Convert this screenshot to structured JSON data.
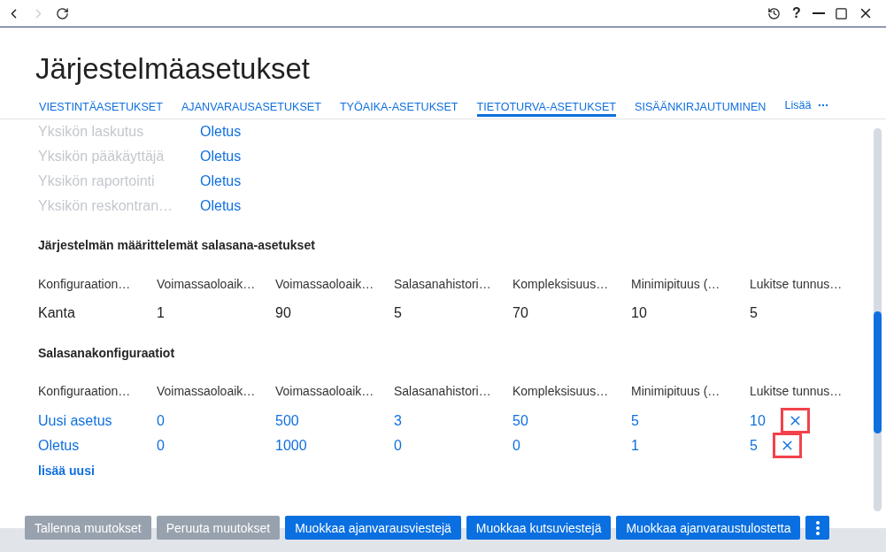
{
  "nav_buttons": [
    {
      "kind": "back",
      "disabled": false
    },
    {
      "kind": "forward",
      "disabled": true
    },
    {
      "kind": "refresh",
      "disabled": false
    }
  ],
  "window_controls": [
    {
      "kind": "history"
    },
    {
      "kind": "help",
      "label": "?"
    },
    {
      "kind": "minimize"
    },
    {
      "kind": "maximize"
    },
    {
      "kind": "close"
    }
  ],
  "page_title": "Järjestelmäasetukset",
  "tabs": [
    {
      "label": "VIESTINTÄASETUKSET",
      "selected": false
    },
    {
      "label": "AJANVARAUSASETUKSET",
      "selected": false
    },
    {
      "label": "TYÖAIKA-ASETUKSET",
      "selected": false
    },
    {
      "label": "TIETOTURVA-ASETUKSET",
      "selected": true
    },
    {
      "label": "SISÄÄNKIRJAUTUMINEN",
      "selected": false
    }
  ],
  "more_tab": {
    "label": "Lisää"
  },
  "unit_settings": [
    {
      "label": "Yksikön laskutus",
      "value": "Oletus",
      "disabled": true
    },
    {
      "label": "Yksikön pääkäyttäjä",
      "value": "Oletus",
      "disabled": true
    },
    {
      "label": "Yksikön raportointi",
      "value": "Oletus",
      "disabled": true
    },
    {
      "label": "Yksikön reskontran…",
      "value": "Oletus",
      "disabled": true
    }
  ],
  "system_settings": {
    "title": "Järjestelmän määrittelemät salasana-asetukset",
    "columns": [
      "Konfiguraation…",
      "Voimassaoloaik…",
      "Voimassaoloaik…",
      "Salasanahistori…",
      "Kompleksisuus…",
      "Minimipituus (…",
      "Lukitse tunnus…"
    ],
    "rows": [
      {
        "cells": [
          "Kanta",
          "1",
          "90",
          "5",
          "70",
          "10",
          "5"
        ]
      }
    ]
  },
  "configurations": {
    "title": "Salasanakonfiguraatiot",
    "columns": [
      "Konfiguraation…",
      "Voimassaoloaik…",
      "Voimassaoloaik…",
      "Salasanahistori…",
      "Kompleksisuus…",
      "Minimipituus (…",
      "Lukitse tunnus…"
    ],
    "rows": [
      {
        "cells": [
          "Uusi asetus",
          "0",
          "500",
          "3",
          "50",
          "5",
          "10"
        ],
        "delete": {
          "highlighted": true
        }
      },
      {
        "cells": [
          "Oletus",
          "0",
          "1000",
          "0",
          "0",
          "1",
          "5"
        ],
        "delete": {
          "highlighted": true
        }
      }
    ],
    "add_link": "lisää uusi"
  },
  "footer_buttons": [
    {
      "label": "Tallenna muutokset",
      "disabled": true
    },
    {
      "label": "Peruuta muutokset",
      "disabled": true
    },
    {
      "label": "Muokkaa ajanvarausviestejä",
      "disabled": false
    },
    {
      "label": "Muokkaa kutsuviestejä",
      "disabled": false
    },
    {
      "label": "Muokkaa ajanvaraustulostetta",
      "disabled": false
    }
  ]
}
